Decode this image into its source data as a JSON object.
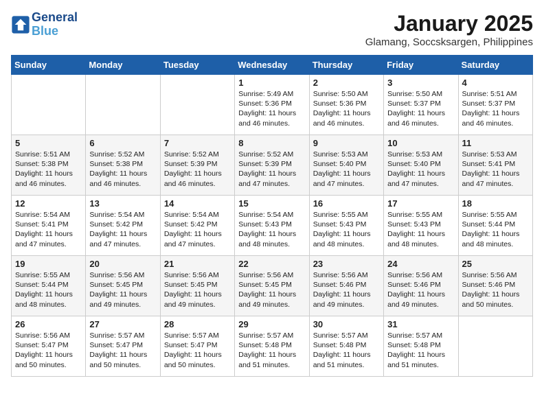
{
  "logo": {
    "line1": "General",
    "line2": "Blue"
  },
  "title": "January 2025",
  "subtitle": "Glamang, Soccsksargen, Philippines",
  "weekdays": [
    "Sunday",
    "Monday",
    "Tuesday",
    "Wednesday",
    "Thursday",
    "Friday",
    "Saturday"
  ],
  "weeks": [
    [
      {
        "day": "",
        "text": ""
      },
      {
        "day": "",
        "text": ""
      },
      {
        "day": "",
        "text": ""
      },
      {
        "day": "1",
        "text": "Sunrise: 5:49 AM\nSunset: 5:36 PM\nDaylight: 11 hours and 46 minutes."
      },
      {
        "day": "2",
        "text": "Sunrise: 5:50 AM\nSunset: 5:36 PM\nDaylight: 11 hours and 46 minutes."
      },
      {
        "day": "3",
        "text": "Sunrise: 5:50 AM\nSunset: 5:37 PM\nDaylight: 11 hours and 46 minutes."
      },
      {
        "day": "4",
        "text": "Sunrise: 5:51 AM\nSunset: 5:37 PM\nDaylight: 11 hours and 46 minutes."
      }
    ],
    [
      {
        "day": "5",
        "text": "Sunrise: 5:51 AM\nSunset: 5:38 PM\nDaylight: 11 hours and 46 minutes."
      },
      {
        "day": "6",
        "text": "Sunrise: 5:52 AM\nSunset: 5:38 PM\nDaylight: 11 hours and 46 minutes."
      },
      {
        "day": "7",
        "text": "Sunrise: 5:52 AM\nSunset: 5:39 PM\nDaylight: 11 hours and 46 minutes."
      },
      {
        "day": "8",
        "text": "Sunrise: 5:52 AM\nSunset: 5:39 PM\nDaylight: 11 hours and 47 minutes."
      },
      {
        "day": "9",
        "text": "Sunrise: 5:53 AM\nSunset: 5:40 PM\nDaylight: 11 hours and 47 minutes."
      },
      {
        "day": "10",
        "text": "Sunrise: 5:53 AM\nSunset: 5:40 PM\nDaylight: 11 hours and 47 minutes."
      },
      {
        "day": "11",
        "text": "Sunrise: 5:53 AM\nSunset: 5:41 PM\nDaylight: 11 hours and 47 minutes."
      }
    ],
    [
      {
        "day": "12",
        "text": "Sunrise: 5:54 AM\nSunset: 5:41 PM\nDaylight: 11 hours and 47 minutes."
      },
      {
        "day": "13",
        "text": "Sunrise: 5:54 AM\nSunset: 5:42 PM\nDaylight: 11 hours and 47 minutes."
      },
      {
        "day": "14",
        "text": "Sunrise: 5:54 AM\nSunset: 5:42 PM\nDaylight: 11 hours and 47 minutes."
      },
      {
        "day": "15",
        "text": "Sunrise: 5:54 AM\nSunset: 5:43 PM\nDaylight: 11 hours and 48 minutes."
      },
      {
        "day": "16",
        "text": "Sunrise: 5:55 AM\nSunset: 5:43 PM\nDaylight: 11 hours and 48 minutes."
      },
      {
        "day": "17",
        "text": "Sunrise: 5:55 AM\nSunset: 5:43 PM\nDaylight: 11 hours and 48 minutes."
      },
      {
        "day": "18",
        "text": "Sunrise: 5:55 AM\nSunset: 5:44 PM\nDaylight: 11 hours and 48 minutes."
      }
    ],
    [
      {
        "day": "19",
        "text": "Sunrise: 5:55 AM\nSunset: 5:44 PM\nDaylight: 11 hours and 48 minutes."
      },
      {
        "day": "20",
        "text": "Sunrise: 5:56 AM\nSunset: 5:45 PM\nDaylight: 11 hours and 49 minutes."
      },
      {
        "day": "21",
        "text": "Sunrise: 5:56 AM\nSunset: 5:45 PM\nDaylight: 11 hours and 49 minutes."
      },
      {
        "day": "22",
        "text": "Sunrise: 5:56 AM\nSunset: 5:45 PM\nDaylight: 11 hours and 49 minutes."
      },
      {
        "day": "23",
        "text": "Sunrise: 5:56 AM\nSunset: 5:46 PM\nDaylight: 11 hours and 49 minutes."
      },
      {
        "day": "24",
        "text": "Sunrise: 5:56 AM\nSunset: 5:46 PM\nDaylight: 11 hours and 49 minutes."
      },
      {
        "day": "25",
        "text": "Sunrise: 5:56 AM\nSunset: 5:46 PM\nDaylight: 11 hours and 50 minutes."
      }
    ],
    [
      {
        "day": "26",
        "text": "Sunrise: 5:56 AM\nSunset: 5:47 PM\nDaylight: 11 hours and 50 minutes."
      },
      {
        "day": "27",
        "text": "Sunrise: 5:57 AM\nSunset: 5:47 PM\nDaylight: 11 hours and 50 minutes."
      },
      {
        "day": "28",
        "text": "Sunrise: 5:57 AM\nSunset: 5:47 PM\nDaylight: 11 hours and 50 minutes."
      },
      {
        "day": "29",
        "text": "Sunrise: 5:57 AM\nSunset: 5:48 PM\nDaylight: 11 hours and 51 minutes."
      },
      {
        "day": "30",
        "text": "Sunrise: 5:57 AM\nSunset: 5:48 PM\nDaylight: 11 hours and 51 minutes."
      },
      {
        "day": "31",
        "text": "Sunrise: 5:57 AM\nSunset: 5:48 PM\nDaylight: 11 hours and 51 minutes."
      },
      {
        "day": "",
        "text": ""
      }
    ]
  ]
}
